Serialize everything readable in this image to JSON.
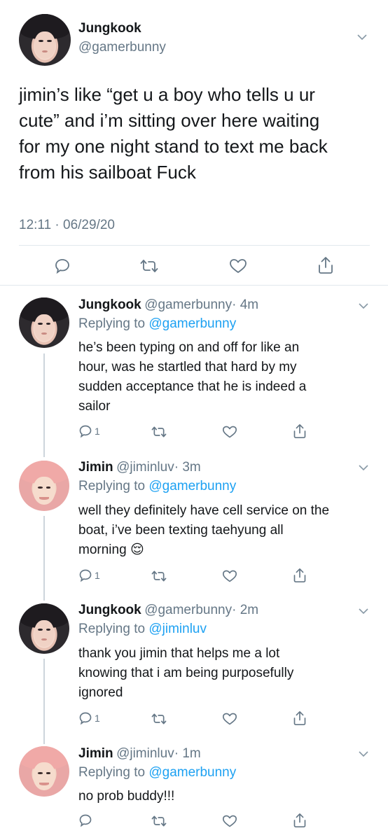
{
  "main_tweet": {
    "author_name": "Jungkook",
    "author_handle": "@gamerbunny",
    "avatar_icon": "profile-photo-jungkook",
    "text_lines": [
      "jimin’s like “get u a boy who tells u ur",
      "cute” and i’m sitting over here waiting",
      "for my one night stand to text me back",
      "from his sailboat Fuck"
    ],
    "timestamp": "12:11 · 06/29/20"
  },
  "replies": [
    {
      "author_name": "Jungkook",
      "author_handle": "@gamerbunny",
      "time": "· 4m",
      "replying_label": "Replying to ",
      "replying_to": "@gamerbunny",
      "text_lines": [
        "he’s been typing on and off for like an",
        "hour, was he startled that hard by my",
        "sudden acceptance that he is indeed a",
        "sailor"
      ],
      "reply_count": "1"
    },
    {
      "author_name": "Jimin",
      "author_handle": "@jiminluv",
      "time": "· 3m",
      "replying_label": "Replying to ",
      "replying_to": "@gamerbunny",
      "text_lines": [
        "well they definitely have cell service on the",
        "boat, i’ve been texting taehyung all",
        "morning"
      ],
      "emoji": "😌",
      "reply_count": "1"
    },
    {
      "author_name": "Jungkook",
      "author_handle": "@gamerbunny",
      "time": "· 2m",
      "replying_label": "Replying to ",
      "replying_to": "@jiminluv",
      "text_lines": [
        "thank you jimin that helps me a lot",
        "knowing that i am being purposefully",
        "ignored"
      ],
      "reply_count": "1"
    },
    {
      "author_name": "Jimin",
      "author_handle": "@jiminluv",
      "time": "· 1m",
      "replying_label": "Replying to ",
      "replying_to": "@gamerbunny",
      "text_lines": [
        "no prob buddy!!!"
      ],
      "reply_count": ""
    }
  ],
  "colors": {
    "accent": "#1da1f2",
    "secondary_text": "#657786",
    "primary_text": "#14171a",
    "divider": "#e1e8ed"
  },
  "icons": [
    "chevron-down-icon",
    "reply-icon",
    "retweet-icon",
    "like-icon",
    "share-icon"
  ]
}
